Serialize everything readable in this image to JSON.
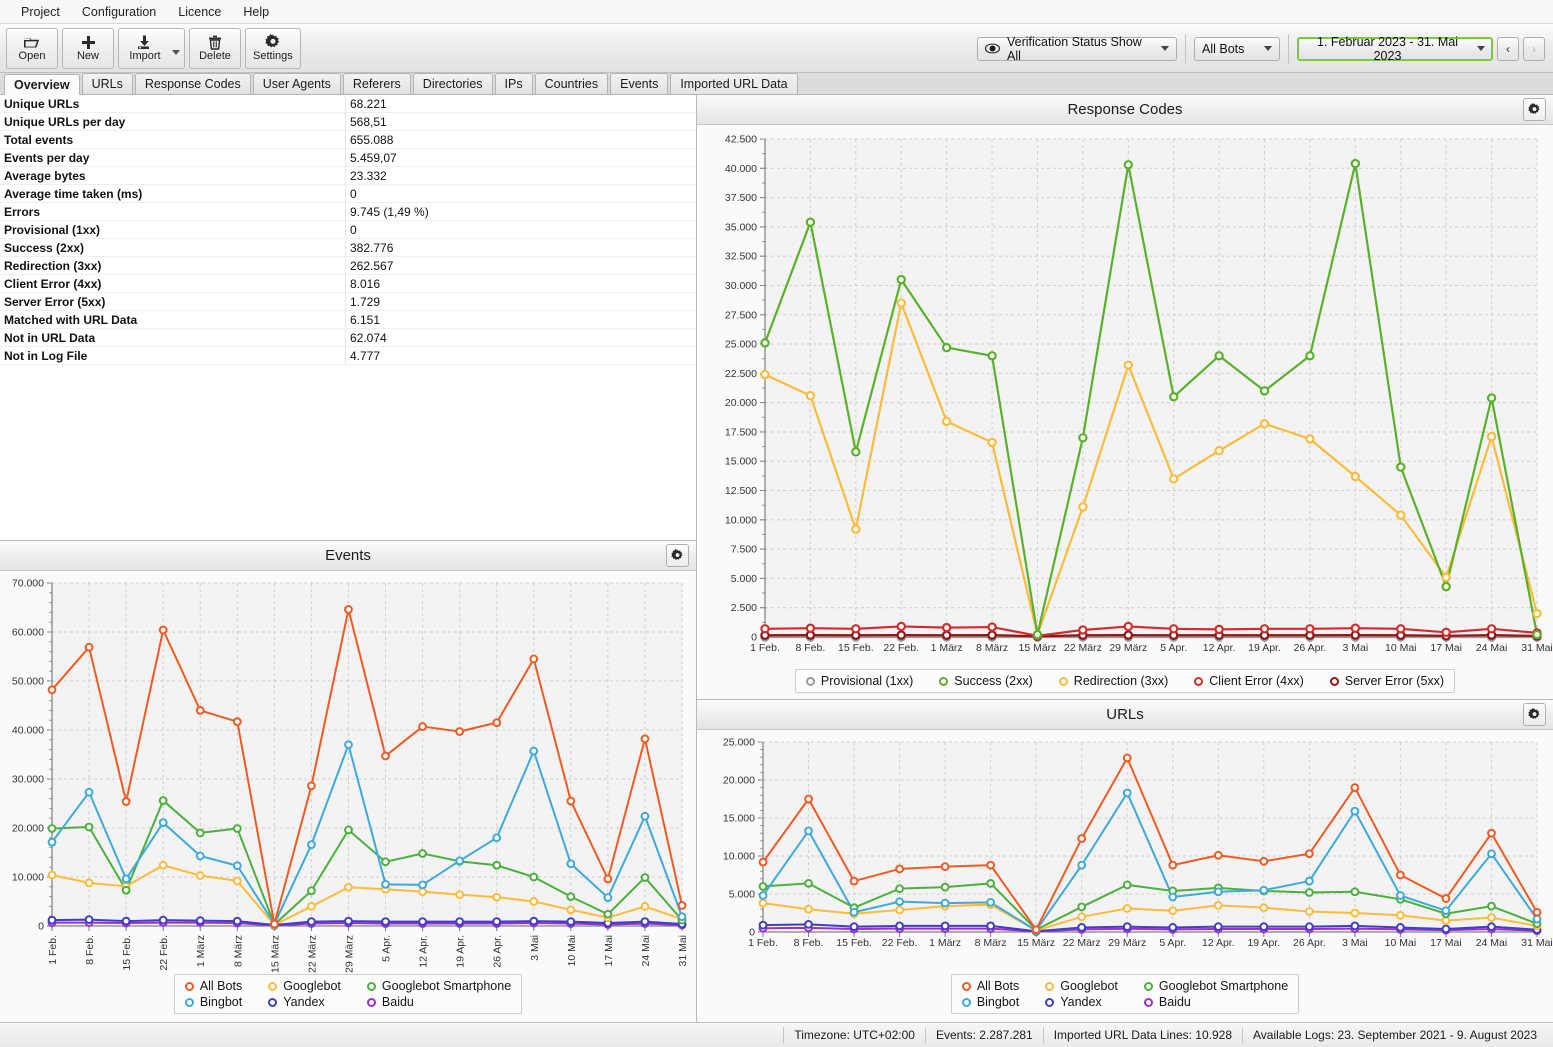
{
  "menubar": {
    "items": [
      "Project",
      "Configuration",
      "Licence",
      "Help"
    ]
  },
  "toolbar": {
    "buttons": [
      {
        "label": "Open",
        "icon": "folder-open-icon"
      },
      {
        "label": "New",
        "icon": "plus-icon"
      },
      {
        "label": "Import",
        "icon": "import-download-icon"
      },
      {
        "label": "Delete",
        "icon": "trash-icon"
      },
      {
        "label": "Settings",
        "icon": "gear-icon"
      }
    ],
    "verification_status": "Verification Status Show All",
    "bots_filter": "All Bots",
    "date_range": "1. Februar 2023 - 31. Mai 2023",
    "prev_label": "‹",
    "next_label": "›"
  },
  "tabs": [
    {
      "label": "Overview",
      "active": true
    },
    {
      "label": "URLs",
      "active": false
    },
    {
      "label": "Response Codes",
      "active": false
    },
    {
      "label": "User Agents",
      "active": false
    },
    {
      "label": "Referers",
      "active": false
    },
    {
      "label": "Directories",
      "active": false
    },
    {
      "label": "IPs",
      "active": false
    },
    {
      "label": "Countries",
      "active": false
    },
    {
      "label": "Events",
      "active": false
    },
    {
      "label": "Imported URL Data",
      "active": false
    }
  ],
  "stats": {
    "rows": [
      {
        "name": "Unique URLs",
        "value": "68.221"
      },
      {
        "name": "Unique URLs per day",
        "value": "568,51"
      },
      {
        "name": "Total events",
        "value": "655.088"
      },
      {
        "name": "Events per day",
        "value": "5.459,07"
      },
      {
        "name": "Average bytes",
        "value": "23.332"
      },
      {
        "name": "Average time taken (ms)",
        "value": "0"
      },
      {
        "name": "Errors",
        "value": "9.745 (1,49 %)"
      },
      {
        "name": "Provisional (1xx)",
        "value": "0"
      },
      {
        "name": "Success (2xx)",
        "value": "382.776"
      },
      {
        "name": "Redirection (3xx)",
        "value": "262.567"
      },
      {
        "name": "Client Error (4xx)",
        "value": "8.016"
      },
      {
        "name": "Server Error (5xx)",
        "value": "1.729"
      },
      {
        "name": "Matched with URL Data",
        "value": "6.151"
      },
      {
        "name": "Not in URL Data",
        "value": "62.074"
      },
      {
        "name": "Not in Log File",
        "value": "4.777"
      }
    ]
  },
  "panels": {
    "response_codes": {
      "title": "Response Codes",
      "gear": "gear-icon"
    },
    "events": {
      "title": "Events",
      "gear": "gear-icon"
    },
    "urls": {
      "title": "URLs",
      "gear": "gear-icon"
    }
  },
  "statusbar": {
    "timezone": "Timezone: UTC+02:00",
    "events": "Events: 2.287.281",
    "imported": "Imported URL Data Lines: 10.928",
    "logs": "Available Logs: 23. September 2021 - 9. August 2023"
  },
  "chart_data": [
    {
      "id": "response_codes",
      "type": "line",
      "title": "Response Codes",
      "xlabel": "",
      "ylabel": "",
      "grid": true,
      "legend_position": "bottom",
      "ylim": [
        0,
        42500
      ],
      "yticks": [
        0,
        2500,
        5000,
        7500,
        10000,
        12500,
        15000,
        17500,
        20000,
        22500,
        25000,
        27500,
        30000,
        32500,
        35000,
        37500,
        40000,
        42500
      ],
      "ytick_labels": [
        "0",
        "2.500",
        "5.000",
        "7.500",
        "10.000",
        "12.500",
        "15.000",
        "17.500",
        "20.000",
        "22.500",
        "25.000",
        "27.500",
        "30.000",
        "32.500",
        "35.000",
        "37.500",
        "40.000",
        "42.500"
      ],
      "categories": [
        "1 Feb.",
        "8 Feb.",
        "15 Feb.",
        "22 Feb.",
        "1 März",
        "8 März",
        "15 März",
        "22 März",
        "29 März",
        "5 Apr.",
        "12 Apr.",
        "19 Apr.",
        "26 Apr.",
        "3 Mai",
        "10 Mai",
        "17 Mai",
        "24 Mai",
        "31 Mai"
      ],
      "series": [
        {
          "name": "Provisional (1xx)",
          "color": "#9a9a9a",
          "values": [
            0,
            0,
            0,
            0,
            0,
            0,
            0,
            0,
            0,
            0,
            0,
            0,
            0,
            0,
            0,
            0,
            0,
            0
          ]
        },
        {
          "name": "Success (2xx)",
          "color": "#5ab02a",
          "values": [
            25100,
            35400,
            15800,
            30500,
            24700,
            24000,
            200,
            17000,
            40300,
            20500,
            24000,
            21000,
            24000,
            40400,
            14500,
            4300,
            20400,
            200
          ]
        },
        {
          "name": "Redirection (3xx)",
          "color": "#fbbb3c",
          "values": [
            22400,
            20600,
            9200,
            28500,
            18400,
            16600,
            200,
            11100,
            23200,
            13500,
            15900,
            18200,
            16900,
            13700,
            10400,
            5100,
            17100,
            2000
          ]
        },
        {
          "name": "Client Error (4xx)",
          "color": "#d42c2c",
          "values": [
            700,
            750,
            700,
            900,
            800,
            850,
            100,
            600,
            900,
            700,
            650,
            700,
            700,
            750,
            700,
            400,
            700,
            350
          ]
        },
        {
          "name": "Server Error (5xx)",
          "color": "#8f1616",
          "values": [
            150,
            160,
            150,
            160,
            150,
            160,
            60,
            150,
            160,
            150,
            150,
            150,
            150,
            160,
            150,
            100,
            160,
            90
          ]
        }
      ]
    },
    {
      "id": "events",
      "type": "line",
      "title": "Events",
      "xlabel": "",
      "ylabel": "",
      "grid": true,
      "legend_position": "bottom",
      "ylim": [
        0,
        70000
      ],
      "yticks": [
        0,
        10000,
        20000,
        30000,
        40000,
        50000,
        60000,
        70000
      ],
      "ytick_labels": [
        "0",
        "10.000",
        "20.000",
        "30.000",
        "40.000",
        "50.000",
        "60.000",
        "70.000"
      ],
      "categories": [
        "1 Feb.",
        "8 Feb.",
        "15 Feb.",
        "22 Feb.",
        "1 März",
        "8 März",
        "15 März",
        "22 März",
        "29 März",
        "5 Apr.",
        "12 Apr.",
        "19 Apr.",
        "26 Apr.",
        "3 Mai",
        "10 Mai",
        "17 Mai",
        "24 Mai",
        "31 Mai"
      ],
      "series": [
        {
          "name": "All Bots",
          "color": "#f15a22",
          "values": [
            48200,
            56900,
            25400,
            60400,
            44000,
            41700,
            400,
            28600,
            64600,
            34700,
            40700,
            39700,
            41500,
            54500,
            25500,
            9600,
            38200,
            4200
          ]
        },
        {
          "name": "Googlebot",
          "color": "#fbbb3c",
          "values": [
            10400,
            8800,
            8100,
            12400,
            10300,
            9200,
            200,
            4000,
            7900,
            7500,
            7000,
            6400,
            5900,
            5000,
            3300,
            1700,
            4000,
            1400
          ]
        },
        {
          "name": "Googlebot Smartphone",
          "color": "#4caf3e",
          "values": [
            19900,
            20200,
            7300,
            25600,
            19000,
            19900,
            300,
            7200,
            19600,
            13100,
            14800,
            13200,
            12400,
            10000,
            6000,
            2400,
            9900,
            1200
          ]
        },
        {
          "name": "Bingbot",
          "color": "#3fa9d8",
          "values": [
            17100,
            27300,
            9600,
            21100,
            14300,
            12300,
            400,
            16600,
            37000,
            8500,
            8400,
            13300,
            18000,
            35700,
            12700,
            5800,
            22400,
            1900
          ]
        },
        {
          "name": "Yandex",
          "color": "#3f3fc0",
          "values": [
            1200,
            1300,
            1000,
            1200,
            1100,
            1000,
            200,
            900,
            1000,
            900,
            900,
            900,
            900,
            1000,
            900,
            600,
            900,
            400
          ]
        },
        {
          "name": "Baidu",
          "color": "#9b30d0",
          "values": [
            700,
            700,
            600,
            700,
            700,
            600,
            100,
            500,
            600,
            500,
            500,
            500,
            500,
            600,
            500,
            300,
            500,
            200
          ]
        }
      ]
    },
    {
      "id": "urls",
      "type": "line",
      "title": "URLs",
      "xlabel": "",
      "ylabel": "",
      "grid": true,
      "legend_position": "bottom",
      "ylim": [
        0,
        25000
      ],
      "yticks": [
        0,
        5000,
        10000,
        15000,
        20000,
        25000
      ],
      "ytick_labels": [
        "0",
        "5.000",
        "10.000",
        "15.000",
        "20.000",
        "25.000"
      ],
      "categories": [
        "1 Feb.",
        "8 Feb.",
        "15 Feb.",
        "22 Feb.",
        "1 März",
        "8 März",
        "15 März",
        "22 März",
        "29 März",
        "5 Apr.",
        "12 Apr.",
        "19 Apr.",
        "26 Apr.",
        "3 Mai",
        "10 Mai",
        "17 Mai",
        "24 Mai",
        "31 Mai"
      ],
      "series": [
        {
          "name": "All Bots",
          "color": "#f15a22",
          "values": [
            9200,
            17500,
            6700,
            8300,
            8600,
            8800,
            300,
            12300,
            22900,
            8800,
            10100,
            9300,
            10300,
            19000,
            7500,
            4400,
            13000,
            2600
          ]
        },
        {
          "name": "Googlebot",
          "color": "#fbbb3c",
          "values": [
            3800,
            3000,
            2400,
            2900,
            3400,
            3600,
            200,
            2000,
            3100,
            2800,
            3500,
            3200,
            2700,
            2500,
            2200,
            1500,
            1900,
            800
          ]
        },
        {
          "name": "Googlebot Smartphone",
          "color": "#4caf3e",
          "values": [
            6000,
            6400,
            3200,
            5700,
            5900,
            6400,
            300,
            3300,
            6200,
            5400,
            5800,
            5400,
            5200,
            5300,
            4300,
            2400,
            3400,
            1100
          ]
        },
        {
          "name": "Bingbot",
          "color": "#3fa9d8",
          "values": [
            4800,
            13300,
            2600,
            4000,
            3800,
            3900,
            200,
            8800,
            18300,
            4600,
            5300,
            5500,
            6700,
            15900,
            4800,
            2800,
            10300,
            1700
          ]
        },
        {
          "name": "Yandex",
          "color": "#3f3fc0",
          "values": [
            900,
            1000,
            700,
            800,
            800,
            800,
            100,
            600,
            700,
            600,
            700,
            700,
            700,
            800,
            600,
            400,
            700,
            300
          ]
        },
        {
          "name": "Baidu",
          "color": "#9b30d0",
          "values": [
            500,
            550,
            400,
            450,
            450,
            450,
            80,
            350,
            420,
            350,
            400,
            400,
            400,
            450,
            350,
            250,
            400,
            180
          ]
        }
      ]
    }
  ],
  "legends": {
    "response_codes": [
      {
        "label": "Provisional (1xx)",
        "color": "#9a9a9a"
      },
      {
        "label": "Success (2xx)",
        "color": "#5ab02a"
      },
      {
        "label": "Redirection (3xx)",
        "color": "#fbbb3c"
      },
      {
        "label": "Client Error (4xx)",
        "color": "#d42c2c"
      },
      {
        "label": "Server Error (5xx)",
        "color": "#8f1616"
      }
    ],
    "bots": [
      {
        "label": "All Bots",
        "color": "#f15a22"
      },
      {
        "label": "Googlebot",
        "color": "#fbbb3c"
      },
      {
        "label": "Googlebot Smartphone",
        "color": "#4caf3e"
      },
      {
        "label": "Bingbot",
        "color": "#3fa9d8"
      },
      {
        "label": "Yandex",
        "color": "#3f3fc0"
      },
      {
        "label": "Baidu",
        "color": "#9b30d0"
      }
    ]
  }
}
